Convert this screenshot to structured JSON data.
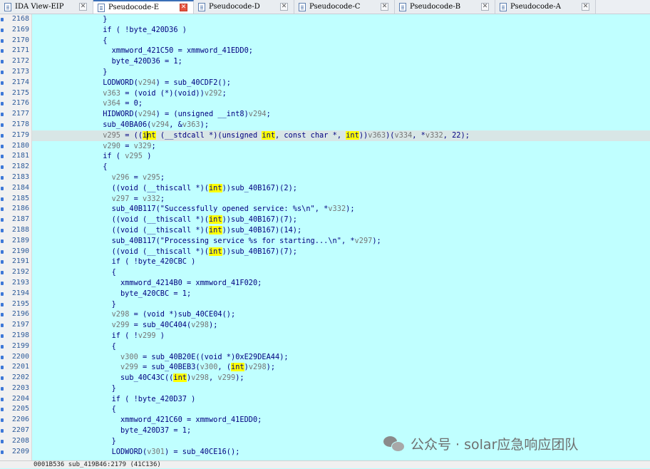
{
  "tabs": [
    {
      "label": "IDA View-EIP",
      "active": false
    },
    {
      "label": "Pseudocode-E",
      "active": true
    },
    {
      "label": "Pseudocode-D",
      "active": false
    },
    {
      "label": "Pseudocode-C",
      "active": false
    },
    {
      "label": "Pseudocode-B",
      "active": false
    },
    {
      "label": "Pseudocode-A",
      "active": false
    }
  ],
  "tab_close_glyph": "✕",
  "current_line": "2179",
  "code_lines": [
    {
      "n": "2168",
      "parts": [
        {
          "t": "                }"
        }
      ]
    },
    {
      "n": "2169",
      "parts": [
        {
          "t": "                if ( !byte_420D36 )"
        }
      ]
    },
    {
      "n": "2170",
      "parts": [
        {
          "t": "                {"
        }
      ]
    },
    {
      "n": "2171",
      "parts": [
        {
          "t": "                  xmmword_421C50 = xmmword_41EDD0;"
        }
      ]
    },
    {
      "n": "2172",
      "parts": [
        {
          "t": "                  byte_420D36 = 1;"
        }
      ]
    },
    {
      "n": "2173",
      "parts": [
        {
          "t": "                }"
        }
      ]
    },
    {
      "n": "2174",
      "parts": [
        {
          "t": "                LODWORD("
        },
        {
          "t": "v294",
          "c": "var"
        },
        {
          "t": ") = sub_40CDF2();"
        }
      ]
    },
    {
      "n": "2175",
      "parts": [
        {
          "t": "                "
        },
        {
          "t": "v363",
          "c": "var"
        },
        {
          "t": " = (void (*)(void))"
        },
        {
          "t": "v292",
          "c": "var"
        },
        {
          "t": ";"
        }
      ]
    },
    {
      "n": "2176",
      "parts": [
        {
          "t": "                "
        },
        {
          "t": "v364",
          "c": "var"
        },
        {
          "t": " = 0;"
        }
      ]
    },
    {
      "n": "2177",
      "parts": [
        {
          "t": "                HIDWORD("
        },
        {
          "t": "v294",
          "c": "var"
        },
        {
          "t": ") = (unsigned __int8)"
        },
        {
          "t": "v294",
          "c": "var"
        },
        {
          "t": ";"
        }
      ]
    },
    {
      "n": "2178",
      "parts": [
        {
          "t": "                sub_40BA06("
        },
        {
          "t": "v294",
          "c": "var"
        },
        {
          "t": ", &"
        },
        {
          "t": "v363",
          "c": "var"
        },
        {
          "t": ");"
        }
      ]
    },
    {
      "n": "2179",
      "parts": [
        {
          "t": "                "
        },
        {
          "t": "v295",
          "c": "var"
        },
        {
          "t": " = (("
        },
        {
          "t": "int",
          "c": "hl"
        },
        {
          "t": " (__stdcall *)(unsigned "
        },
        {
          "t": "int",
          "c": "hl"
        },
        {
          "t": ", const char *, "
        },
        {
          "t": "int",
          "c": "hl"
        },
        {
          "t": "))"
        },
        {
          "t": "v363",
          "c": "var"
        },
        {
          "t": ")("
        },
        {
          "t": "v334",
          "c": "var"
        },
        {
          "t": ", *"
        },
        {
          "t": "v332",
          "c": "var"
        },
        {
          "t": ", 22);"
        }
      ]
    },
    {
      "n": "2180",
      "parts": [
        {
          "t": "                "
        },
        {
          "t": "v290",
          "c": "var"
        },
        {
          "t": " = "
        },
        {
          "t": "v329",
          "c": "var"
        },
        {
          "t": ";"
        }
      ]
    },
    {
      "n": "2181",
      "parts": [
        {
          "t": "                if ( "
        },
        {
          "t": "v295",
          "c": "var"
        },
        {
          "t": " )"
        }
      ]
    },
    {
      "n": "2182",
      "parts": [
        {
          "t": "                {"
        }
      ]
    },
    {
      "n": "2183",
      "parts": [
        {
          "t": "                  "
        },
        {
          "t": "v296",
          "c": "var"
        },
        {
          "t": " = "
        },
        {
          "t": "v295",
          "c": "var"
        },
        {
          "t": ";"
        }
      ]
    },
    {
      "n": "2184",
      "parts": [
        {
          "t": "                  ((void (__thiscall *)("
        },
        {
          "t": "int",
          "c": "hl"
        },
        {
          "t": "))sub_40B167)(2);"
        }
      ]
    },
    {
      "n": "2185",
      "parts": [
        {
          "t": "                  "
        },
        {
          "t": "v297",
          "c": "var"
        },
        {
          "t": " = "
        },
        {
          "t": "v332",
          "c": "var"
        },
        {
          "t": ";"
        }
      ]
    },
    {
      "n": "2186",
      "parts": [
        {
          "t": "                  sub_40B117(\"Successfully opened service: %s\\n\", *"
        },
        {
          "t": "v332",
          "c": "var"
        },
        {
          "t": ");"
        }
      ]
    },
    {
      "n": "2187",
      "parts": [
        {
          "t": "                  ((void (__thiscall *)("
        },
        {
          "t": "int",
          "c": "hl"
        },
        {
          "t": "))sub_40B167)(7);"
        }
      ]
    },
    {
      "n": "2188",
      "parts": [
        {
          "t": "                  ((void (__thiscall *)("
        },
        {
          "t": "int",
          "c": "hl"
        },
        {
          "t": "))sub_40B167)(14);"
        }
      ]
    },
    {
      "n": "2189",
      "parts": [
        {
          "t": "                  sub_40B117(\"Processing service %s for starting...\\n\", *"
        },
        {
          "t": "v297",
          "c": "var"
        },
        {
          "t": ");"
        }
      ]
    },
    {
      "n": "2190",
      "parts": [
        {
          "t": "                  ((void (__thiscall *)("
        },
        {
          "t": "int",
          "c": "hl"
        },
        {
          "t": "))sub_40B167)(7);"
        }
      ]
    },
    {
      "n": "2191",
      "parts": [
        {
          "t": "                  if ( !byte_420CBC )"
        }
      ]
    },
    {
      "n": "2192",
      "parts": [
        {
          "t": "                  {"
        }
      ]
    },
    {
      "n": "2193",
      "parts": [
        {
          "t": "                    xmmword_4214B0 = xmmword_41F020;"
        }
      ]
    },
    {
      "n": "2194",
      "parts": [
        {
          "t": "                    byte_420CBC = 1;"
        }
      ]
    },
    {
      "n": "2195",
      "parts": [
        {
          "t": "                  }"
        }
      ]
    },
    {
      "n": "2196",
      "parts": [
        {
          "t": "                  "
        },
        {
          "t": "v298",
          "c": "var"
        },
        {
          "t": " = (void *)sub_40CE04();"
        }
      ]
    },
    {
      "n": "2197",
      "parts": [
        {
          "t": "                  "
        },
        {
          "t": "v299",
          "c": "var"
        },
        {
          "t": " = sub_40C404("
        },
        {
          "t": "v298",
          "c": "var"
        },
        {
          "t": ");"
        }
      ]
    },
    {
      "n": "2198",
      "parts": [
        {
          "t": "                  if ( !"
        },
        {
          "t": "v299",
          "c": "var"
        },
        {
          "t": " )"
        }
      ]
    },
    {
      "n": "2199",
      "parts": [
        {
          "t": "                  {"
        }
      ]
    },
    {
      "n": "2200",
      "parts": [
        {
          "t": "                    "
        },
        {
          "t": "v300",
          "c": "var"
        },
        {
          "t": " = sub_40B20E((void *)0xE29DEA44);"
        }
      ]
    },
    {
      "n": "2201",
      "parts": [
        {
          "t": "                    "
        },
        {
          "t": "v299",
          "c": "var"
        },
        {
          "t": " = sub_40BEB3("
        },
        {
          "t": "v300",
          "c": "var"
        },
        {
          "t": ", ("
        },
        {
          "t": "int",
          "c": "hl"
        },
        {
          "t": ")"
        },
        {
          "t": "v298",
          "c": "var"
        },
        {
          "t": ");"
        }
      ]
    },
    {
      "n": "2202",
      "parts": [
        {
          "t": "                    sub_40C43C(("
        },
        {
          "t": "int",
          "c": "hl"
        },
        {
          "t": ")"
        },
        {
          "t": "v298",
          "c": "var"
        },
        {
          "t": ", "
        },
        {
          "t": "v299",
          "c": "var"
        },
        {
          "t": ");"
        }
      ]
    },
    {
      "n": "2203",
      "parts": [
        {
          "t": "                  }"
        }
      ]
    },
    {
      "n": "2204",
      "parts": [
        {
          "t": "                  if ( !byte_420D37 )"
        }
      ]
    },
    {
      "n": "2205",
      "parts": [
        {
          "t": "                  {"
        }
      ]
    },
    {
      "n": "2206",
      "parts": [
        {
          "t": "                    xmmword_421C60 = xmmword_41EDD0;"
        }
      ]
    },
    {
      "n": "2207",
      "parts": [
        {
          "t": "                    byte_420D37 = 1;"
        }
      ]
    },
    {
      "n": "2208",
      "parts": [
        {
          "t": "                  }"
        }
      ]
    },
    {
      "n": "2209",
      "parts": [
        {
          "t": "                  LODWORD("
        },
        {
          "t": "v301",
          "c": "var"
        },
        {
          "t": ") = sub_40CE16();"
        }
      ]
    }
  ],
  "status": {
    "text": "0001B536 sub_419B46:2179 (41C136)"
  },
  "watermark": {
    "text": "公众号 · solar应急响应团队"
  },
  "colors": {
    "code_bg": "#c0ffff",
    "keyword_text": "#000080",
    "variable": "#757575",
    "highlight": "#ffff00",
    "current_line_bg": "#d8e6e6"
  }
}
